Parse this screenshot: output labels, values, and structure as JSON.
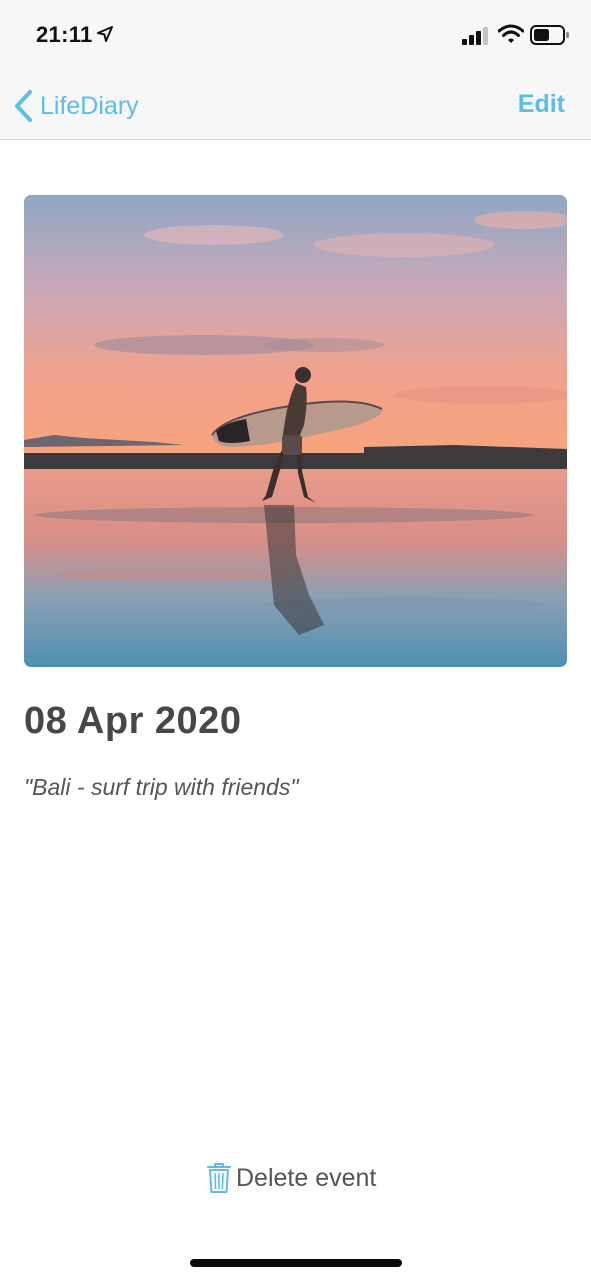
{
  "status_bar": {
    "time": "21:11",
    "icons": [
      "location-arrow-icon",
      "cellular-signal-icon",
      "wifi-icon",
      "battery-icon"
    ]
  },
  "nav": {
    "back_label": "LifeDiary",
    "edit_label": "Edit",
    "back_icon": "chevron-left-icon"
  },
  "event": {
    "date": "08 Apr 2020",
    "caption": "\"Bali - surf trip with friends\"",
    "photo_description_icon": "surfer-sunset-photo"
  },
  "actions": {
    "delete_label": "Delete event",
    "delete_icon": "trash-icon"
  },
  "colors": {
    "accent": "#5bbde8",
    "nav_background": "#f7f7f7",
    "title_text": "#474747"
  }
}
